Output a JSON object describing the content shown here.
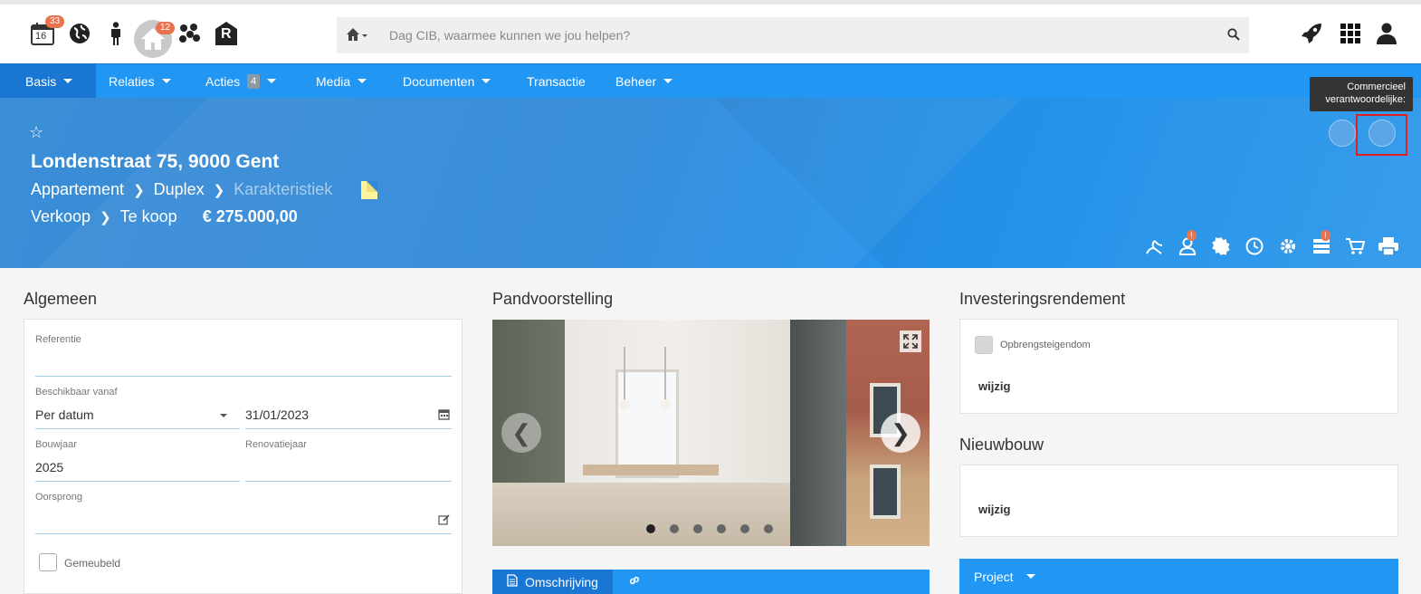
{
  "header": {
    "calendar_badge": "33",
    "calendar_day": "16",
    "house_badge": "12",
    "logo_letter": "R",
    "search_placeholder": "Dag CIB, waarmee kunnen we jou helpen?"
  },
  "nav": {
    "items": [
      {
        "label": "Basis",
        "dropdown": true,
        "active": true
      },
      {
        "label": "Relaties",
        "dropdown": true
      },
      {
        "label": "Acties",
        "count": "4",
        "dropdown": true
      },
      {
        "label": "Media",
        "dropdown": true
      },
      {
        "label": "Documenten",
        "dropdown": true
      },
      {
        "label": "Transactie",
        "dropdown": false
      },
      {
        "label": "Beheer",
        "dropdown": true
      }
    ]
  },
  "banner": {
    "address": "Londenstraat 75, 9000 Gent",
    "type": "Appartement",
    "subtype": "Duplex",
    "characteristic": "Karakteristiek",
    "transaction": "Verkoop",
    "status": "Te koop",
    "price": "€ 275.000,00",
    "tooltip_line1": "Commercieel",
    "tooltip_line2": "verantwoordelijke:",
    "person_badge": "!",
    "stack_badge": "!"
  },
  "algemeen": {
    "title": "Algemeen",
    "referentie_label": "Referentie",
    "referentie_value": "",
    "beschikbaar_label": "Beschikbaar vanaf",
    "beschikbaar_select": "Per datum",
    "beschikbaar_date": "31/01/2023",
    "bouwjaar_label": "Bouwjaar",
    "bouwjaar_value": "2025",
    "renovatie_label": "Renovatiejaar",
    "renovatie_value": "",
    "oorsprong_label": "Oorsprong",
    "gemeubeld_label": "Gemeubeld"
  },
  "pand": {
    "title": "Pandvoorstelling",
    "slide_count": 6,
    "active_slide": 0,
    "tabs": [
      {
        "label": "Omschrijving",
        "active": true
      },
      {
        "label": ""
      }
    ]
  },
  "investering": {
    "title": "Investeringsrendement",
    "checkbox_label": "Opbrengsteigendom",
    "edit_label": "wijzig"
  },
  "nieuwbouw": {
    "title": "Nieuwbouw",
    "edit_label": "wijzig"
  },
  "project": {
    "label": "Project"
  },
  "colors": {
    "primary": "#2196f3",
    "primary_dark": "#1976d2",
    "badge": "#e8734e"
  }
}
